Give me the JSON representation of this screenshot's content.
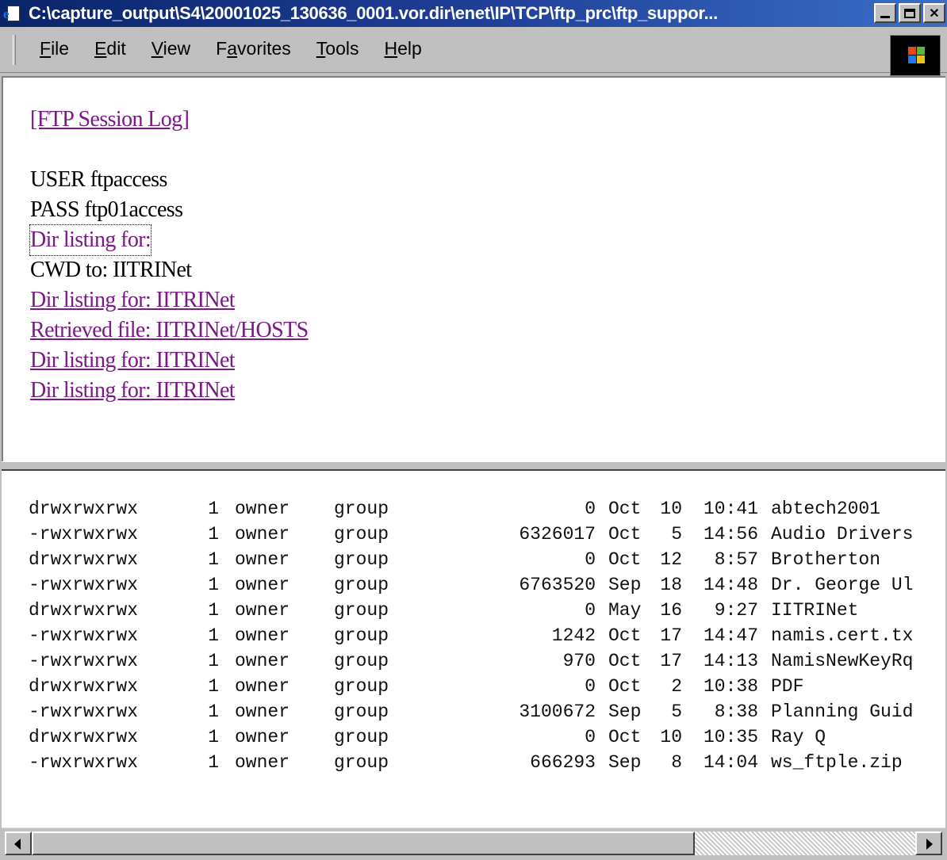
{
  "window": {
    "title": "C:\\capture_output\\S4\\20001025_130636_0001.vor.dir\\enet\\IP\\TCP\\ftp_prc\\ftp_suppor..."
  },
  "menu": [
    {
      "pre": "",
      "key": "F",
      "post": "ile"
    },
    {
      "pre": "",
      "key": "E",
      "post": "dit"
    },
    {
      "pre": "",
      "key": "V",
      "post": "iew"
    },
    {
      "pre": "F",
      "key": "a",
      "post": "vorites"
    },
    {
      "pre": "",
      "key": "T",
      "post": "ools"
    },
    {
      "pre": "",
      "key": "H",
      "post": "elp"
    }
  ],
  "log": {
    "heading": "[FTP Session Log]",
    "entries": [
      {
        "text": "USER ftpaccess",
        "link": false
      },
      {
        "text": "PASS ftp01access",
        "link": false
      },
      {
        "text": "Dir listing for:",
        "link": true,
        "focused": true
      },
      {
        "text": "CWD to: IITRINet",
        "link": false
      },
      {
        "text": "Dir listing for: IITRINet",
        "link": true
      },
      {
        "text": "Retrieved file: IITRINet/HOSTS",
        "link": true
      },
      {
        "text": "Dir listing for: IITRINet",
        "link": true
      },
      {
        "text": "Dir listing for: IITRINet",
        "link": true
      }
    ]
  },
  "listing": [
    {
      "perm": "drwxrwxrwx",
      "links": "1",
      "owner": "owner",
      "group": "group",
      "size": "0",
      "month": "Oct",
      "day": "10",
      "time": "10:41",
      "name": "abtech2001"
    },
    {
      "perm": "-rwxrwxrwx",
      "links": "1",
      "owner": "owner",
      "group": "group",
      "size": "6326017",
      "month": "Oct",
      "day": "5",
      "time": "14:56",
      "name": "Audio Drivers"
    },
    {
      "perm": "drwxrwxrwx",
      "links": "1",
      "owner": "owner",
      "group": "group",
      "size": "0",
      "month": "Oct",
      "day": "12",
      "time": "8:57",
      "name": "Brotherton"
    },
    {
      "perm": "-rwxrwxrwx",
      "links": "1",
      "owner": "owner",
      "group": "group",
      "size": "6763520",
      "month": "Sep",
      "day": "18",
      "time": "14:48",
      "name": "Dr. George Ul"
    },
    {
      "perm": "drwxrwxrwx",
      "links": "1",
      "owner": "owner",
      "group": "group",
      "size": "0",
      "month": "May",
      "day": "16",
      "time": "9:27",
      "name": "IITRINet"
    },
    {
      "perm": "-rwxrwxrwx",
      "links": "1",
      "owner": "owner",
      "group": "group",
      "size": "1242",
      "month": "Oct",
      "day": "17",
      "time": "14:47",
      "name": "namis.cert.tx"
    },
    {
      "perm": "-rwxrwxrwx",
      "links": "1",
      "owner": "owner",
      "group": "group",
      "size": "970",
      "month": "Oct",
      "day": "17",
      "time": "14:13",
      "name": "NamisNewKeyRq"
    },
    {
      "perm": "drwxrwxrwx",
      "links": "1",
      "owner": "owner",
      "group": "group",
      "size": "0",
      "month": "Oct",
      "day": "2",
      "time": "10:38",
      "name": "PDF"
    },
    {
      "perm": "-rwxrwxrwx",
      "links": "1",
      "owner": "owner",
      "group": "group",
      "size": "3100672",
      "month": "Sep",
      "day": "5",
      "time": "8:38",
      "name": "Planning Guid"
    },
    {
      "perm": "drwxrwxrwx",
      "links": "1",
      "owner": "owner",
      "group": "group",
      "size": "0",
      "month": "Oct",
      "day": "10",
      "time": "10:35",
      "name": "Ray Q"
    },
    {
      "perm": "-rwxrwxrwx",
      "links": "1",
      "owner": "owner",
      "group": "group",
      "size": "666293",
      "month": "Sep",
      "day": "8",
      "time": "14:04",
      "name": "ws_ftple.zip"
    }
  ],
  "scrollbar": {
    "horizontal_position": 0.0,
    "visible_fraction": 0.75
  },
  "colors": {
    "titlebar_start": "#0a246a",
    "titlebar_end": "#3a6ec8",
    "link": "#7a1a86",
    "chrome": "#c0c0c0"
  }
}
